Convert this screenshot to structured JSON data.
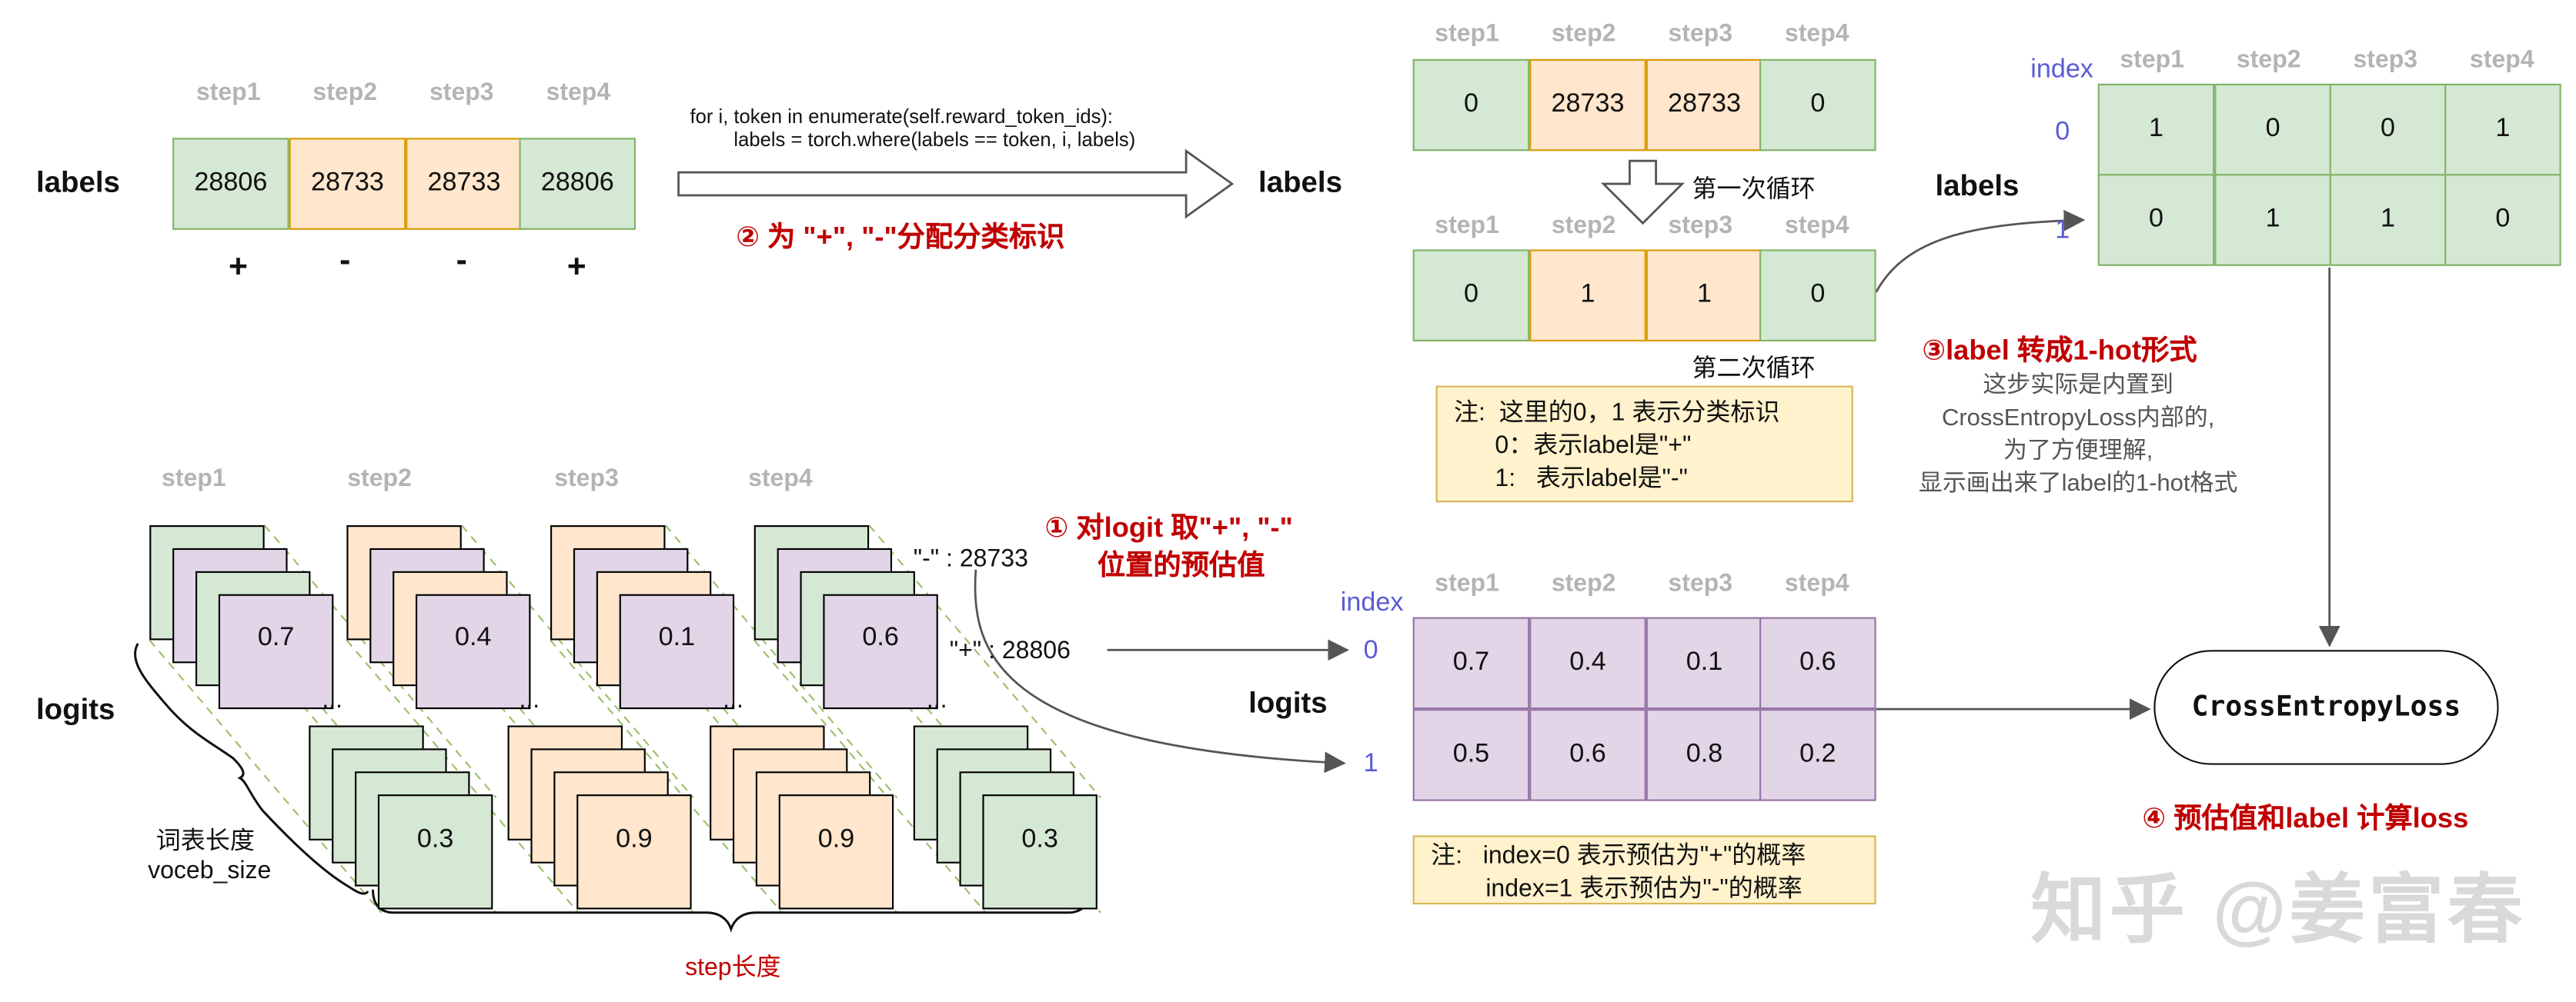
{
  "steps": [
    "step1",
    "step2",
    "step3",
    "step4"
  ],
  "labels_title": "labels",
  "logits_title": "logits",
  "index_label": "index",
  "index_0": "0",
  "index_1": "1",
  "input_labels": {
    "values": [
      "28806",
      "28733",
      "28733",
      "28806"
    ],
    "colors": [
      "#d5e8d4",
      "#ffe6cc",
      "#ffe6cc",
      "#d5e8d4"
    ],
    "signs": [
      "+",
      "-",
      "-",
      "+"
    ]
  },
  "code_text": "for i, token in enumerate(self.reward_token_ids):\n        labels = torch.where(labels == token, i, labels)",
  "step2_caption": "② 为 \"+\", \"-\"分配分类标识",
  "loop1": {
    "values": [
      "0",
      "28733",
      "28733",
      "0"
    ],
    "caption": "第一次循环"
  },
  "loop2": {
    "values": [
      "0",
      "1",
      "1",
      "0"
    ],
    "caption": "第二次循环"
  },
  "note_labels": "注:  这里的0，1 表示分类标识\n      0：表示label是\"+\"\n      1:   表示label是\"-\"",
  "onehot": {
    "row0": [
      "1",
      "0",
      "0",
      "1"
    ],
    "row1": [
      "0",
      "1",
      "1",
      "0"
    ]
  },
  "step3_caption": "③label 转成1-hot形式",
  "step3_desc": [
    "这步实际是内置到",
    "CrossEntropyLoss内部的,",
    "为了方便理解,",
    "显示画出来了label的1-hot格式"
  ],
  "step1_caption": [
    "① 对logit 取\"+\", \"-\"",
    "位置的预估值"
  ],
  "token_minus": "\"-\" : 28733",
  "token_plus": "\"+\" : 28806",
  "logit_cards": {
    "top": [
      "0.7",
      "0.4",
      "0.1",
      "0.6"
    ],
    "bottom": [
      "0.3",
      "0.9",
      "0.9",
      "0.3"
    ],
    "dots": "..."
  },
  "vocab_label": [
    "词表长度",
    "voceb_size"
  ],
  "step_length_label": "step长度",
  "pred": {
    "row0": [
      "0.7",
      "0.4",
      "0.1",
      "0.6"
    ],
    "row1": [
      "0.5",
      "0.6",
      "0.8",
      "0.2"
    ]
  },
  "note_index": "注:   index=0 表示预估为\"+\"的概率\n        index=1 表示预估为\"-\"的概率",
  "loss_node": "CrossEntropyLoss",
  "step4_caption": "④ 预估值和label 计算loss",
  "watermark": "知乎 @姜富春"
}
